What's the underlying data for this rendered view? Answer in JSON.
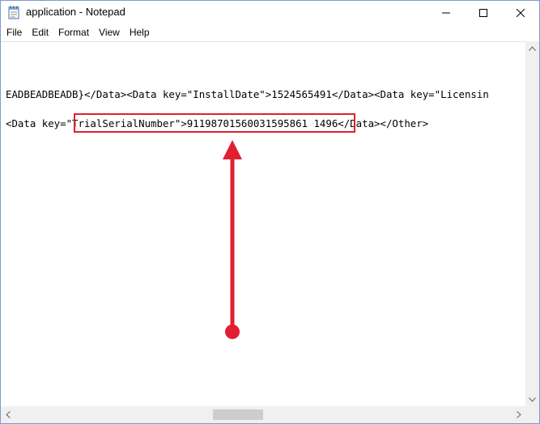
{
  "window": {
    "title": "application - Notepad"
  },
  "menu": {
    "items": [
      "File",
      "Edit",
      "Format",
      "View",
      "Help"
    ]
  },
  "editor": {
    "line1": "EADBEADBEADB}</Data><Data key=\"InstallDate\">1524565491</Data><Data key=\"Licensin",
    "line2": "<Data key=\"TrialSerialNumber\">91198701560031595861 1496</Data></Other>"
  },
  "colors": {
    "annotation": "#e02030",
    "window_border": "#7a9bd1"
  },
  "icons": {
    "app": "notepad-icon",
    "minimize": "minimize-icon",
    "maximize": "maximize-icon",
    "close": "close-icon"
  }
}
